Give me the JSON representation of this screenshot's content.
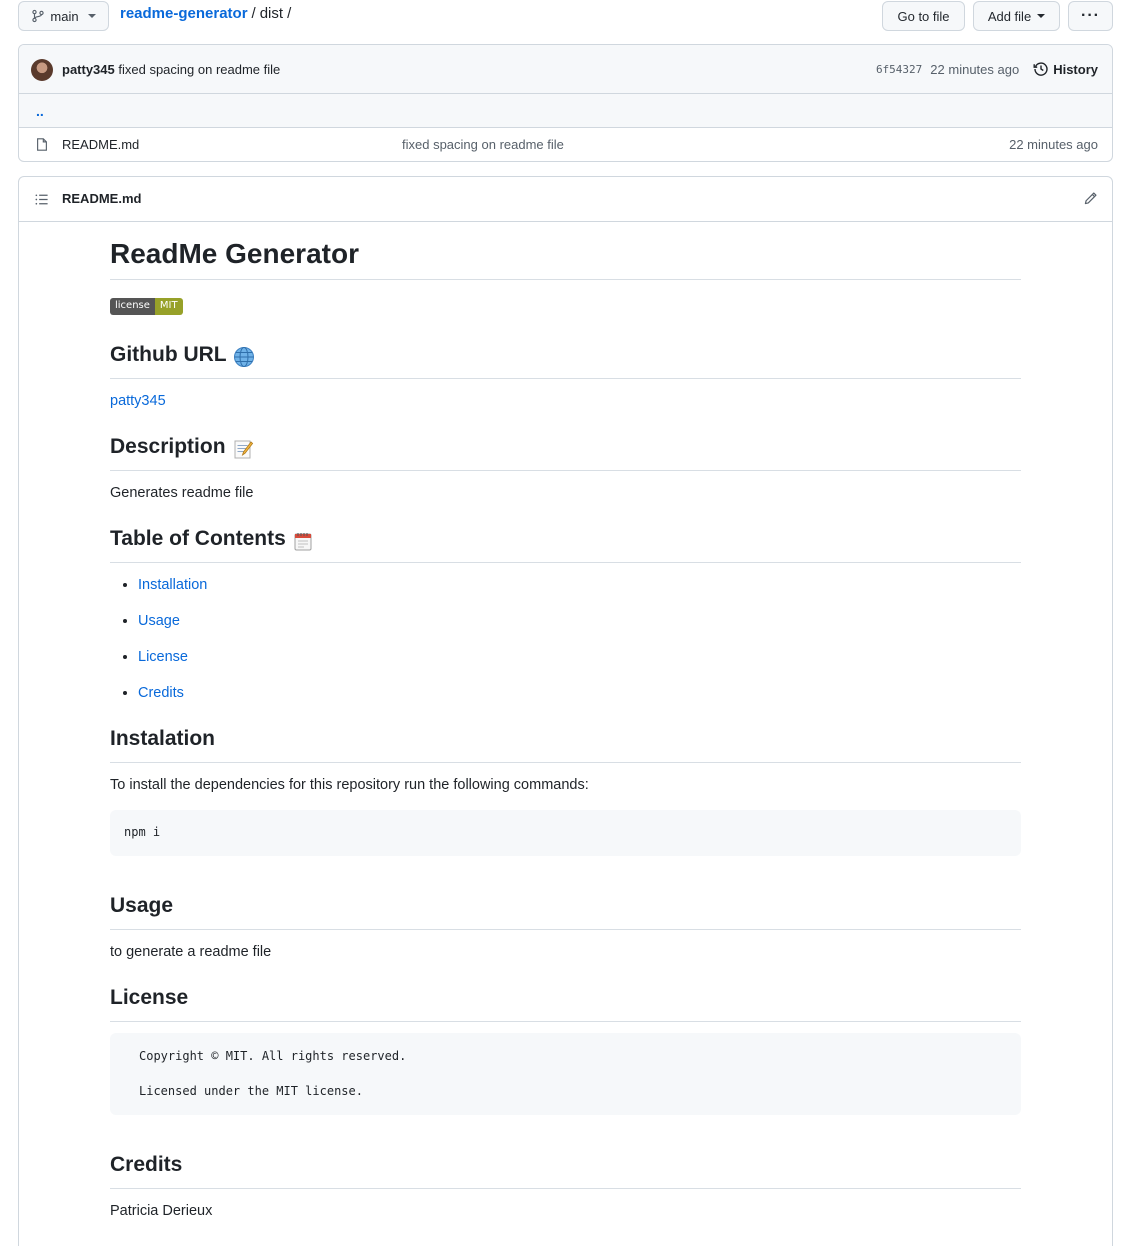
{
  "topbar": {
    "branch": "main",
    "repo": "readme-generator",
    "separator": "/",
    "dir": "dist",
    "trailing": "/",
    "go_to_file": "Go to file",
    "add_file": "Add file",
    "more": "···"
  },
  "commit": {
    "author": "patty345",
    "message": "fixed spacing on readme file",
    "sha": "6f54327",
    "age": "22 minutes ago",
    "history": "History"
  },
  "files": {
    "parent": "..",
    "rows": [
      {
        "name": "README.md",
        "message": "fixed spacing on readme file",
        "age": "22 minutes ago"
      }
    ]
  },
  "readme": {
    "filename": "README.md",
    "title": "ReadMe Generator",
    "badge": {
      "label": "license",
      "value": "MIT"
    },
    "github_heading": "Github URL",
    "github_link": "patty345",
    "description_heading": "Description",
    "description": "Generates readme file",
    "toc_heading": "Table of Contents",
    "toc": [
      "Installation",
      "Usage",
      "License",
      "Credits"
    ],
    "install_heading": "Instalation",
    "install_text": "To install the dependencies for this repository run the following commands:",
    "install_code": "npm i",
    "usage_heading": "Usage",
    "usage_text": "to generate a readme file",
    "license_heading": "License",
    "license_line1": "Copyright © MIT. All rights reserved.",
    "license_line2": "Licensed under the MIT license.",
    "credits_heading": "Credits",
    "credits_text": "Patricia Derieux"
  },
  "icons": {
    "branch": "git-branch-icon",
    "history": "history-icon",
    "file": "file-icon",
    "list": "list-unordered-icon",
    "pencil": "pencil-icon",
    "globe": "globe-emoji",
    "memo": "memo-emoji",
    "calendar": "spiral-calendar-emoji"
  }
}
